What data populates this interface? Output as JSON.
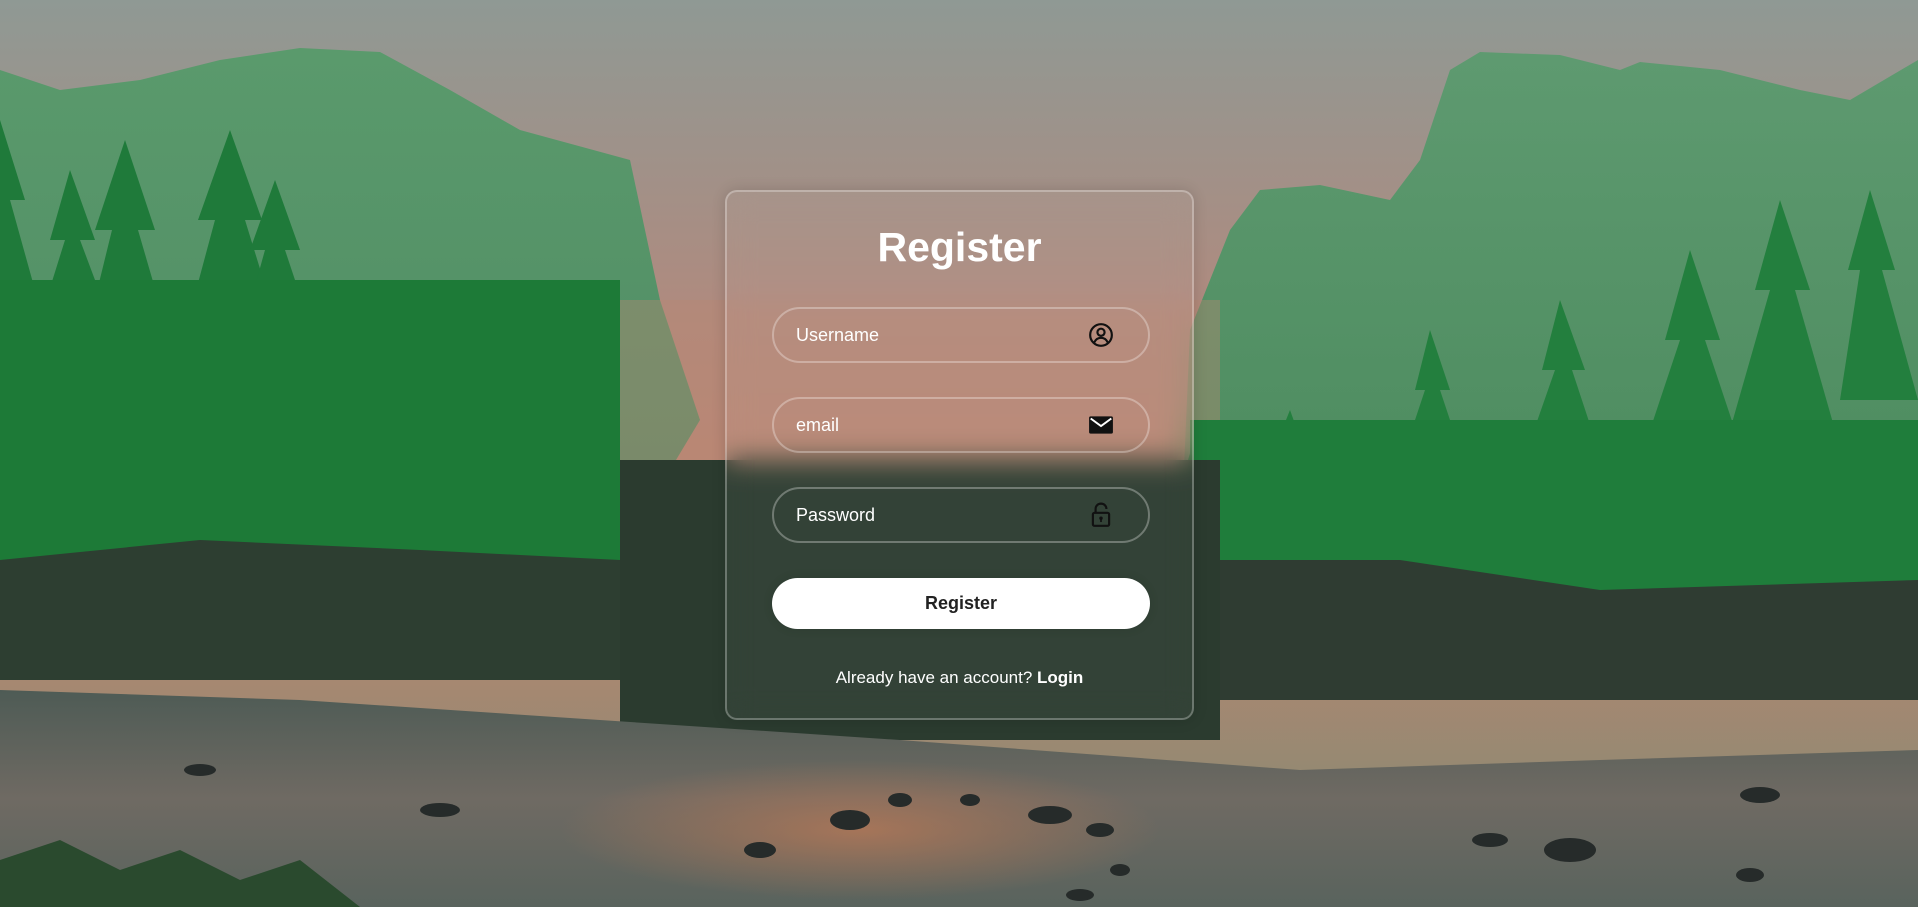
{
  "form": {
    "title": "Register",
    "username_placeholder": "Username",
    "email_placeholder": "email",
    "password_placeholder": "Password",
    "submit_label": "Register",
    "footer_prompt": "Already have an account?",
    "login_link": "Login"
  },
  "icons": {
    "username": "user-circle-icon",
    "email": "envelope-icon",
    "password": "lock-icon"
  },
  "colors": {
    "text": "#ffffff",
    "button_bg": "#ffffff",
    "button_text": "#222222",
    "forest_tint": "#1e8f3c"
  }
}
